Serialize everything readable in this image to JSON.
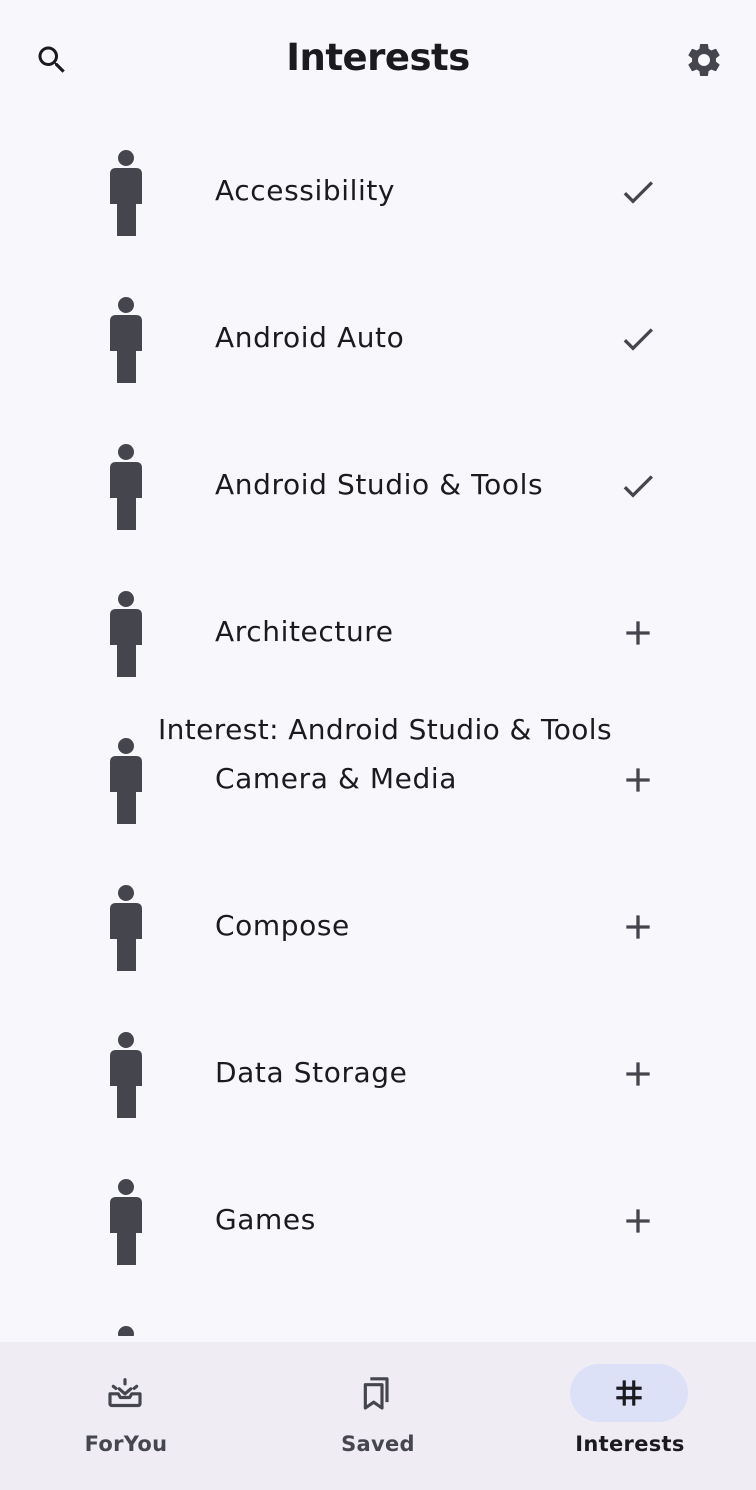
{
  "header": {
    "title": "Interests",
    "search_icon": "search-icon",
    "settings_icon": "gear-icon"
  },
  "interests": [
    {
      "name": "Accessibility",
      "followed": true
    },
    {
      "name": "Android Auto",
      "followed": true
    },
    {
      "name": "Android Studio & Tools",
      "followed": true
    },
    {
      "name": "Architecture",
      "followed": false
    },
    {
      "name": "Camera & Media",
      "followed": false
    },
    {
      "name": "Compose",
      "followed": false
    },
    {
      "name": "Data Storage",
      "followed": false
    },
    {
      "name": "Games",
      "followed": false
    }
  ],
  "tooltip": {
    "text": "Interest: Android Studio & Tools"
  },
  "nav": {
    "items": [
      {
        "label": "ForYou",
        "icon": "inbox-upcoming-icon",
        "selected": false
      },
      {
        "label": "Saved",
        "icon": "bookmarks-icon",
        "selected": false
      },
      {
        "label": "Interests",
        "icon": "hashtag-icon",
        "selected": true
      }
    ]
  },
  "colors": {
    "background": "#f8f7fc",
    "navbar": "#efedf3",
    "selected_pill": "#dce1f8",
    "icon": "#45464d"
  }
}
